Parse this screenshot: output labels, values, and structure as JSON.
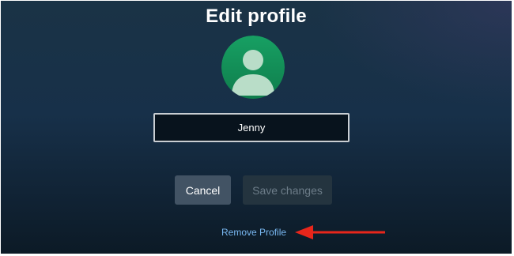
{
  "page": {
    "title": "Edit profile"
  },
  "avatar": {
    "icon": "person-silhouette-icon",
    "background_color": "#14915a"
  },
  "name_input": {
    "value": "Jenny"
  },
  "buttons": {
    "cancel_label": "Cancel",
    "save_label": "Save changes"
  },
  "remove_link": {
    "label": "Remove Profile"
  },
  "annotation": {
    "icon": "left-arrow-icon",
    "color": "#e8261b"
  }
}
